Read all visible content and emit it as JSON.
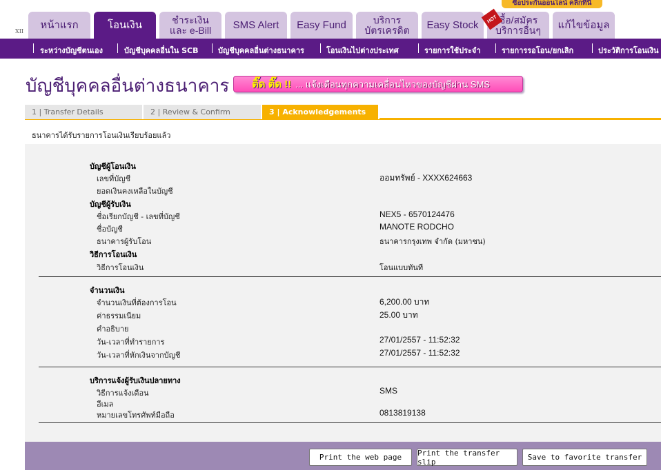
{
  "header": {
    "font_control": "XII",
    "promo_text": "ซื้อประกันออนไลน์ คลิกที่นี่",
    "hot_badge": "HOT",
    "tabs": [
      {
        "label": "หน้าแรก"
      },
      {
        "label": "โอนเงิน"
      },
      {
        "label": "ชำระเงิน\nและ e-Bill"
      },
      {
        "label": "SMS Alert"
      },
      {
        "label": "Easy Fund"
      },
      {
        "label": "บริการ\nบัตรเครดิต"
      },
      {
        "label": "Easy Stock"
      },
      {
        "label": "ซื้อ/สมัคร\nบริการอื่นๆ"
      },
      {
        "label": "แก้ไขข้อมูล"
      }
    ]
  },
  "subnav": {
    "items": [
      {
        "label": "ระหว่างบัญชีตนเอง"
      },
      {
        "label": "บัญชีบุคคลอื่นใน SCB"
      },
      {
        "label": "บัญชีบุคคลอื่นต่างธนาคาร"
      },
      {
        "label": "โอนเงินไปต่างประเทศ"
      },
      {
        "label": "รายการใช้ประจำ"
      },
      {
        "label": "รายการรอโอน/ยกเลิก"
      },
      {
        "label": "ประวัติการโอนเงิน"
      }
    ]
  },
  "page": {
    "title": "บัญชีบุคคลอื่นต่างธนาคาร",
    "banner_tag": "ติ๊ด ติ๊ด !!",
    "banner_text": "... แจ้งเตือนทุกความเคลื่อนไหวของบัญชีผ่าน SMS",
    "status_message": "ธนาคารได้รับรายการโอนเงินเรียบร้อยแล้ว"
  },
  "steps": [
    {
      "label": "1 | Transfer Details"
    },
    {
      "label": "2 | Review & Confirm"
    },
    {
      "label": "3 | Acknowledgements"
    }
  ],
  "details": {
    "from_section": "บัญชีผู้โอนเงิน",
    "account_no_label": "เลขที่บัญชี",
    "account_no_value": "ออมทรัพย์ - XXXX624663",
    "balance_label": "ยอดเงินคงเหลือในบัญชี",
    "to_section": "บัญชีผู้รับเงิน",
    "nickname_label": "ชื่อเรียกบัญชี - เลขที่บัญชี",
    "nickname_value": "NEX5 - 6570124476",
    "account_name_label": "ชื่อบัญชี",
    "account_name_value": "MANOTE RODCHO",
    "receiving_bank_label": "ธนาคารผู้รับโอน",
    "receiving_bank_value": "ธนาคารกรุงเทพ จำกัด (มหาชน)",
    "method_section": "วิธีการโอนเงิน",
    "method_label": "วิธีการโอนเงิน",
    "method_value": "โอนแบบทันที",
    "amount_section": "จำนวนเงิน",
    "amount_label": "จำนวนเงินที่ต้องการโอน",
    "amount_value": "6,200.00 บาท",
    "fee_label": "ค่าธรรมเนียม",
    "fee_value": "25.00  บาท",
    "description_label": "คำอธิบาย",
    "txn_time_label": "วัน-เวลาที่ทำรายการ",
    "txn_time_value": "27/01/2557 - 11:52:32",
    "debit_time_label": "วัน-เวลาที่หักเงินจากบัญชี",
    "debit_time_value": "27/01/2557 - 11:52:32",
    "notify_section": "บริการแจ้งผู้รับเงินปลายทาง",
    "notify_method_label": "วิธีการแจ้งเตือน",
    "notify_method_value": "SMS",
    "email_label": "อีเมล",
    "mobile_label": "หมายเลขโทรศัพท์มือถือ",
    "mobile_value": "0813819138"
  },
  "actions": {
    "print_page": "Print the web page",
    "print_slip": "Print the transfer slip",
    "save_favorite": "Save to favorite transfer"
  },
  "colors": {
    "brand_purple": "#5b1b86",
    "tab_light": "#d4c4e0",
    "step_active": "#f7b100",
    "bottom_bar": "#9d89b4"
  }
}
